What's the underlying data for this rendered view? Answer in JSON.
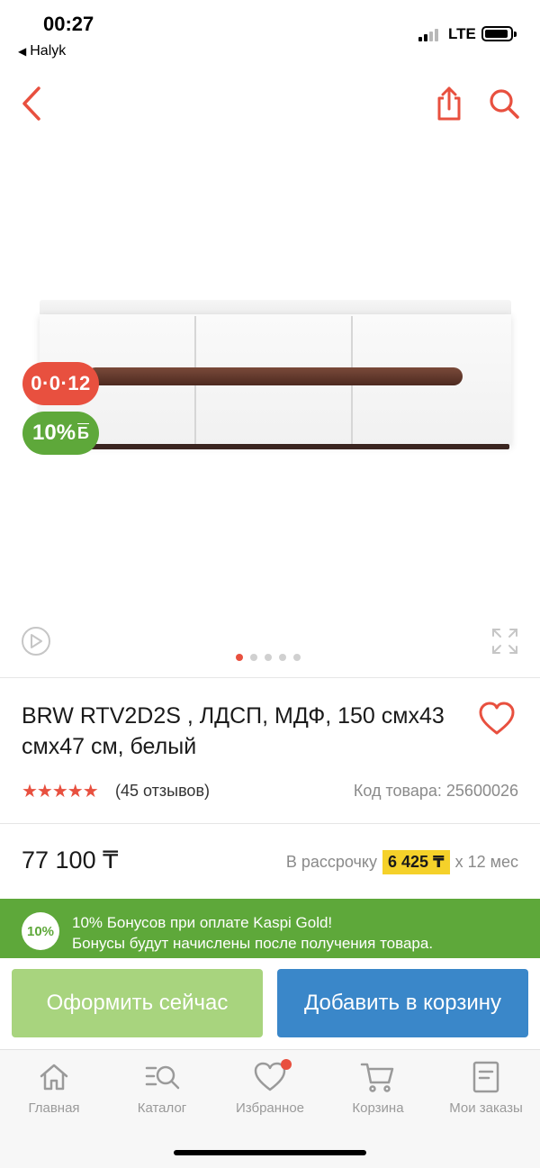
{
  "status_bar": {
    "time": "00:27",
    "back_app": "Halyk",
    "network": "LTE"
  },
  "gallery": {
    "installment_badge": "0·0·12",
    "bonus_badge": "10%",
    "bonus_badge_currency": "Б",
    "active_dot": 0,
    "dot_count": 5
  },
  "product": {
    "title": "BRW RTV2D2S , ЛДСП, МДФ, 150 смх43 смх47 см, белый",
    "rating_stars": "★★★★★",
    "reviews": "(45 отзывов)",
    "sku": "Код товара: 25600026",
    "price": "77 100 ₸",
    "installment_prefix": "В рассрочку",
    "installment_monthly": "6 425 ₸",
    "installment_suffix": "х 12 мес"
  },
  "bonus_banner": {
    "circle": "10%",
    "line1": "10% Бонусов при оплате Kaspi Gold!",
    "line2": "Бонусы будут начислены после получения товара."
  },
  "actions": {
    "buy_now": "Оформить сейчас",
    "add_to_cart": "Добавить в корзину"
  },
  "tabbar": {
    "home": "Главная",
    "catalog": "Каталог",
    "favorites": "Избранное",
    "cart": "Корзина",
    "orders": "Мои заказы"
  },
  "colors": {
    "accent_red": "#e8503f",
    "bonus_green": "#5ea83a",
    "buy_button": "#a8d47e",
    "cart_button": "#3a87c9",
    "installment_highlight": "#f5d12a"
  }
}
